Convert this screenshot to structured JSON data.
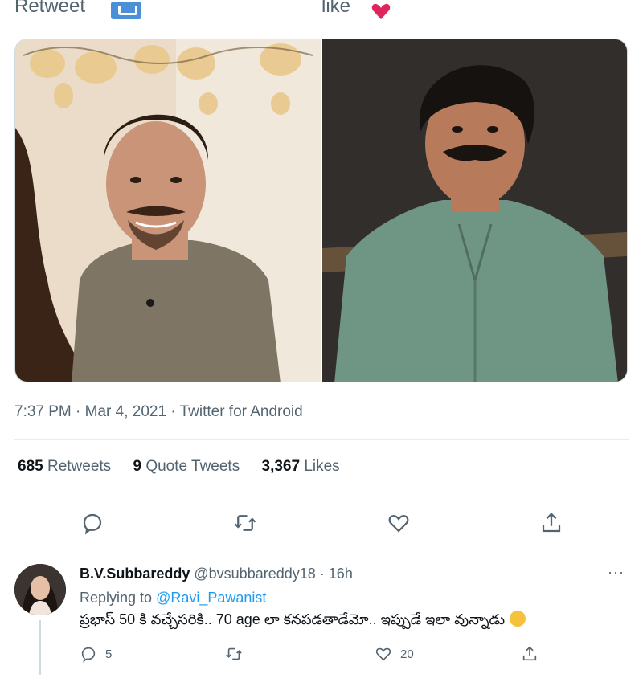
{
  "top_bar": {
    "retweet_label": "Retweet",
    "like_label": "like"
  },
  "tweet": {
    "timestamp": "7:37 PM · Mar 4, 2021 · Twitter for Android",
    "stats": {
      "retweets_count": "685",
      "retweets_label": "Retweets",
      "quote_count": "9",
      "quote_label": "Quote Tweets",
      "likes_count": "3,367",
      "likes_label": "Likes"
    },
    "actions": [
      "reply-icon",
      "retweet-icon",
      "like-icon",
      "share-icon"
    ]
  },
  "reply": {
    "name": "B.V.Subbareddy",
    "handle": "@bvsubbareddy18",
    "separator": "·",
    "time": "16h",
    "more": "···",
    "replying_to_label": "Replying to",
    "replying_to_handle": "@Ravi_Pawanist",
    "text": "ప్రభాస్ 50 కి వచ్చేసరికి.. 70 age లా కనపడతాడేమో.. ఇప్పుడే ఇలా వున్నాడు",
    "reply_count": "5",
    "retweet_count": "",
    "like_count": "20"
  },
  "colors": {
    "accent": "#1d9bf0",
    "muted_text": "#536471",
    "heart": "#e0245e"
  }
}
